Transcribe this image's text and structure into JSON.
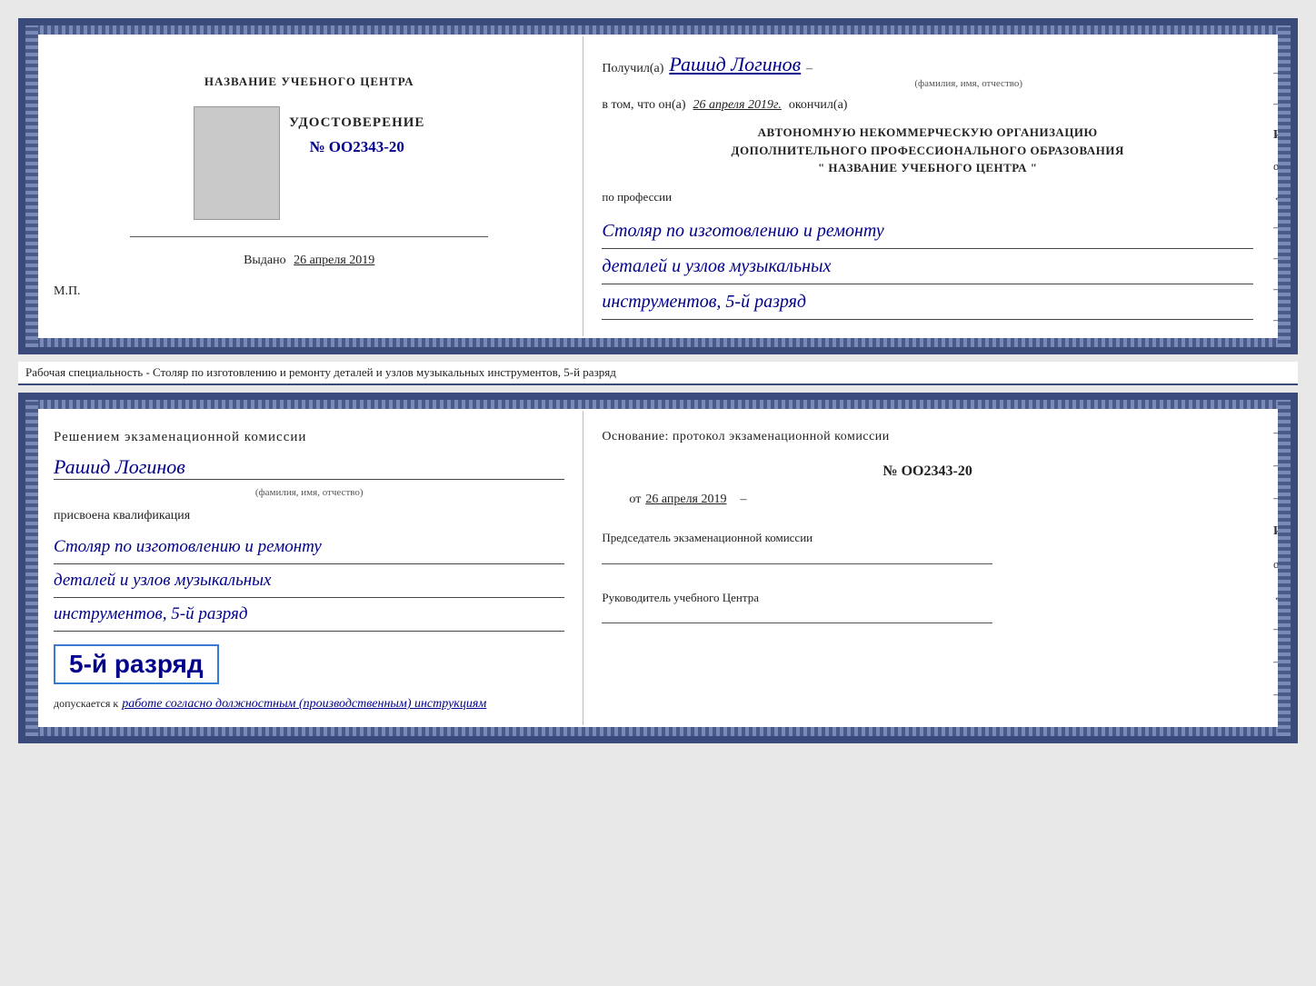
{
  "page": {
    "background": "#e8e8e8"
  },
  "top_cert": {
    "left": {
      "training_center_label": "НАЗВАНИЕ УЧЕБНОГО ЦЕНТРА",
      "document_type": "УДОСТОВЕРЕНИЕ",
      "number": "№ OO2343-20",
      "issued_label": "Выдано",
      "issued_date": "26 апреля 2019",
      "mp_label": "М.П."
    },
    "right": {
      "received_label": "Получил(а)",
      "recipient_name": "Рашид Логинов",
      "fio_label": "(фамилия, имя, отчество)",
      "in_that_label": "в том, что он(а)",
      "completion_date": "26 апреля 2019г.",
      "finished_label": "окончил(а)",
      "org_line1": "АВТОНОМНУЮ НЕКОММЕРЧЕСКУЮ ОРГАНИЗАЦИЮ",
      "org_line2": "ДОПОЛНИТЕЛЬНОГО ПРОФЕССИОНАЛЬНОГО ОБРАЗОВАНИЯ",
      "org_name": "\"   НАЗВАНИЕ УЧЕБНОГО ЦЕНТРА   \"",
      "profession_label": "по профессии",
      "profession_line1": "Столяр по изготовлению и ремонту",
      "profession_line2": "деталей и узлов музыкальных",
      "profession_line3": "инструментов, 5-й разряд"
    }
  },
  "specialty_bar": {
    "text": "Рабочая специальность - Столяр по изготовлению и ремонту деталей и узлов музыкальных инструментов, 5-й разряд"
  },
  "bottom_cert": {
    "left": {
      "commission_text": "Решением экзаменационной комиссии",
      "recipient_name": "Рашид Логинов",
      "fio_label": "(фамилия, имя, отчество)",
      "qualification_label": "присвоена квалификация",
      "qualification_line1": "Столяр по изготовлению и ремонту",
      "qualification_line2": "деталей и узлов музыкальных",
      "qualification_line3": "инструментов, 5-й разряд",
      "rank_text": "5-й разряд",
      "allowed_label": "допускается к",
      "allowed_handwritten": "работе согласно должностным (производственным) инструкциям"
    },
    "right": {
      "basis_label": "Основание: протокол экзаменационной комиссии",
      "protocol_number": "№  OO2343-20",
      "from_label": "от",
      "from_date": "26 апреля 2019",
      "chairman_label": "Председатель экзаменационной комиссии",
      "center_head_label": "Руководитель учебного Центра"
    }
  }
}
